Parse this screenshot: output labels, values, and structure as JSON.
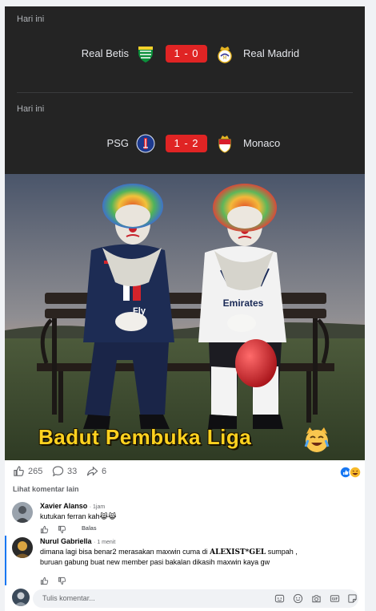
{
  "matches": [
    {
      "day": "Hari ini",
      "home": "Real Betis",
      "score": "1 - 0",
      "away": "Real Madrid"
    },
    {
      "day": "Hari ini",
      "home": "PSG",
      "score": "1 - 2",
      "away": "Monaco"
    }
  ],
  "photo": {
    "caption": "Badut Pembuka Liga",
    "left_jersey_text": "Fly",
    "right_jersey_text": "Emirates"
  },
  "reactions": {
    "likes": "265",
    "comments": "33",
    "shares": "6"
  },
  "comments_header": {
    "see_more": "Lihat komentar lain"
  },
  "comments": [
    {
      "name": "Xavier Alanso",
      "time": "· 1jam",
      "text": "kutukan ferran kah😹😹",
      "reply": "Balas"
    },
    {
      "name": "Nurul Gabriella",
      "time": "· 1 menit",
      "text_before": "dimana lagi bisa benar2 merasakan maxwin cuma di ",
      "brand": "ALEXIST*GEL",
      "text_after": " sumpah , buruan gabung buat new member pasi bakalan dikasih maxwin kaya gw"
    }
  ],
  "composer": {
    "placeholder": "Tulis komentar..."
  }
}
